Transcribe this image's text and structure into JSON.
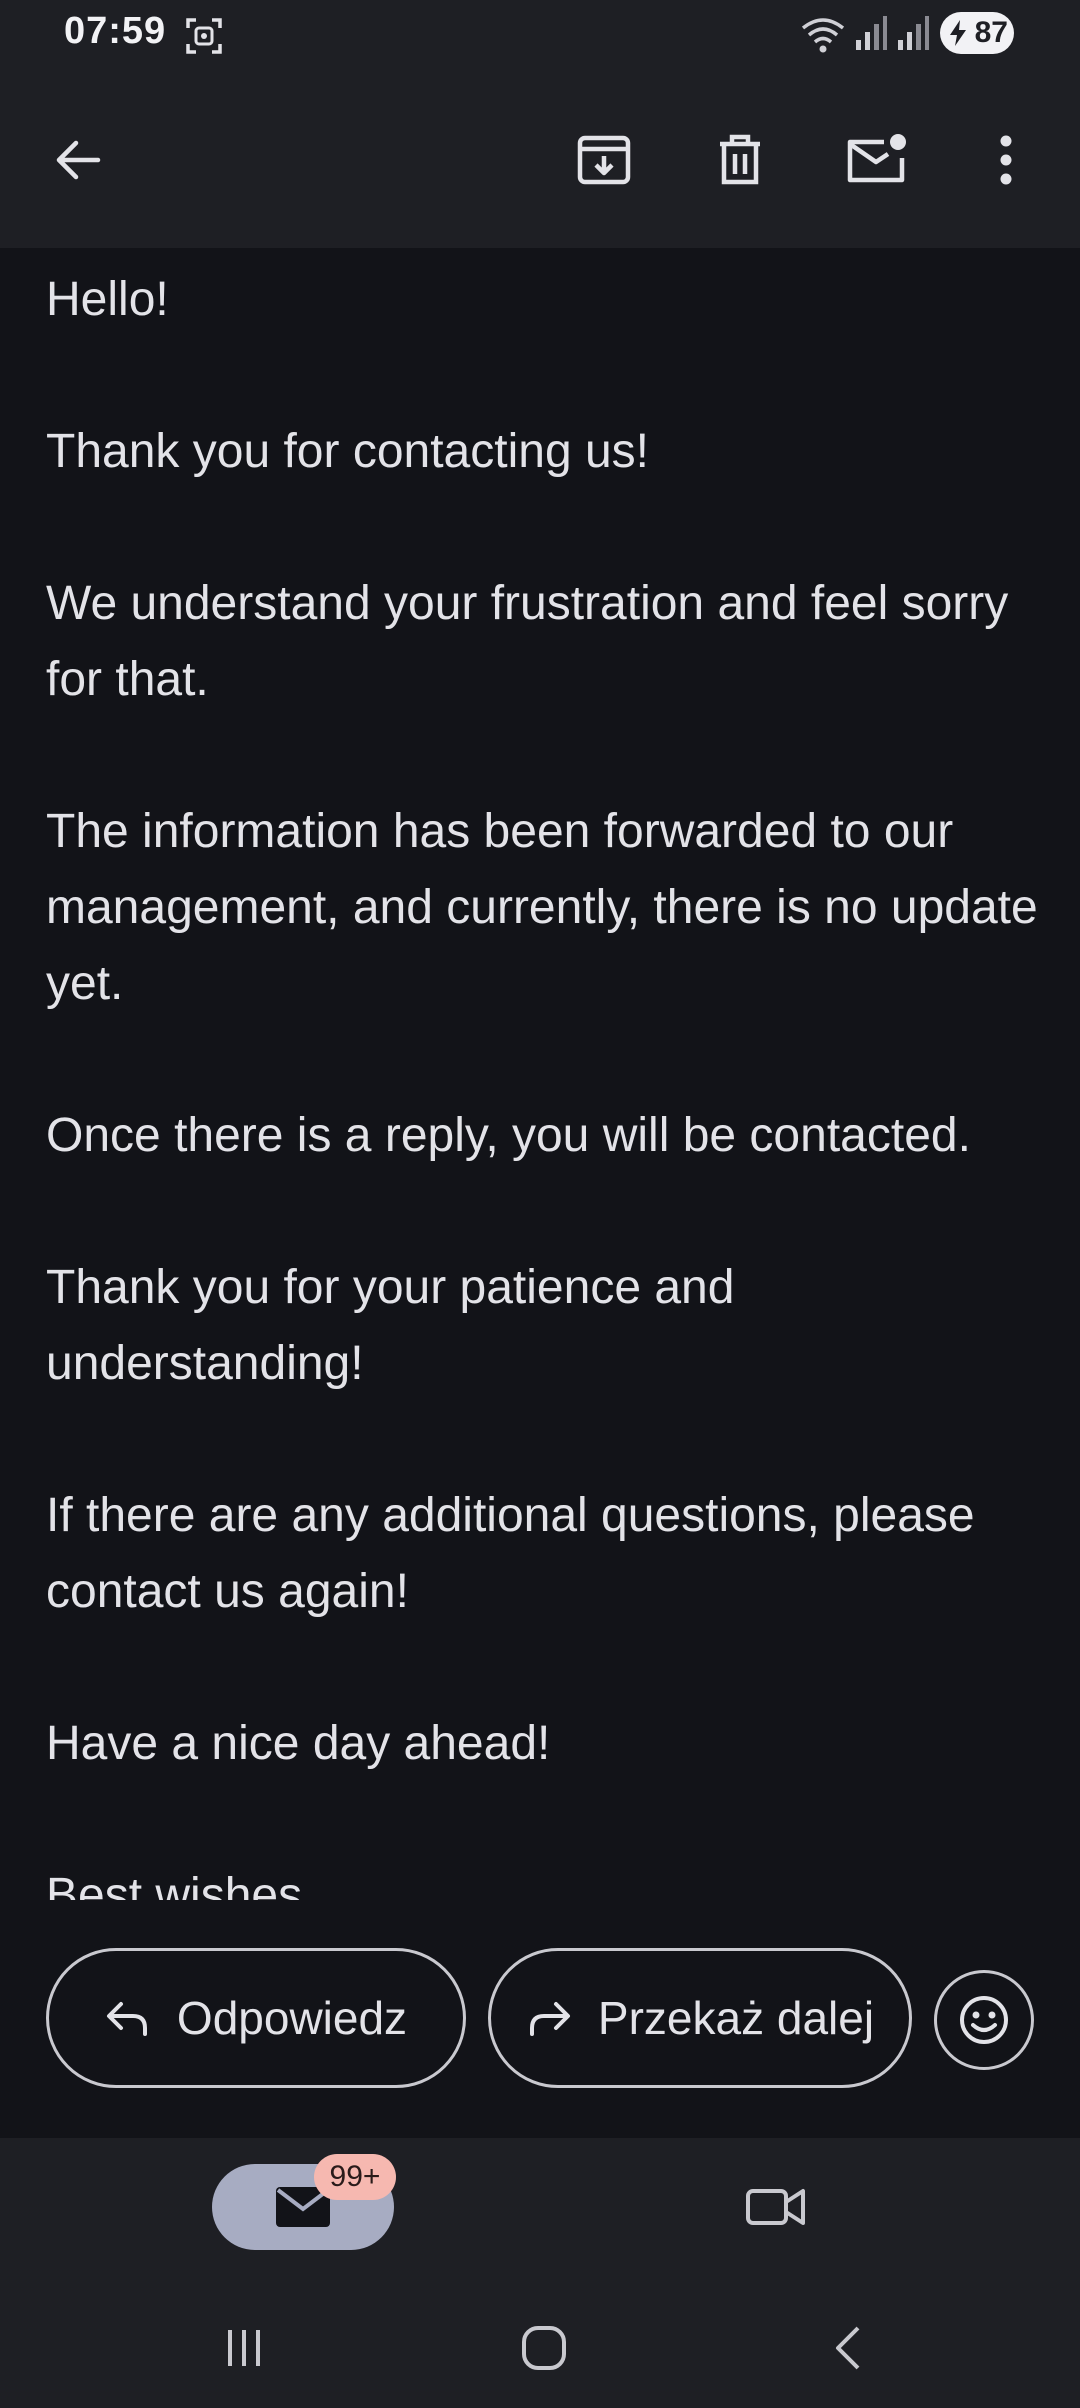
{
  "status_bar": {
    "time": "07:59",
    "battery": "87",
    "icons": [
      "screenshot-icon",
      "wifi-icon",
      "signal-icon",
      "signal-icon",
      "battery-icon"
    ]
  },
  "toolbar": {
    "icons": [
      "back-arrow-icon",
      "archive-icon",
      "delete-icon",
      "mark-unread-icon",
      "more-options-icon"
    ]
  },
  "email": {
    "paragraphs": [
      "Hello!",
      "Thank you for contacting us!",
      "We understand your frustration and feel sorry for that.",
      "The information has been forwarded to our management, and currently, there is no update yet.",
      "Once there is a reply, you will be contacted.",
      "Thank you for your patience and understanding!",
      "If there are any additional questions, please contact us again!",
      "Have a nice day ahead!",
      "Best wishes"
    ]
  },
  "actions": {
    "reply_label": "Odpowiedz",
    "forward_label": "Przekaż dalej",
    "icons": [
      "reply-icon",
      "forward-icon",
      "emoji-reaction-icon"
    ]
  },
  "bottom_nav": {
    "mail_badge": "99+",
    "icons": [
      "mail-icon",
      "video-camera-icon"
    ]
  },
  "colors": {
    "background": "#121318",
    "bars": "#1e1f24",
    "text": "#e3e3e8",
    "active_tab": "#a7acc2",
    "badge": "#f6b8b0"
  }
}
